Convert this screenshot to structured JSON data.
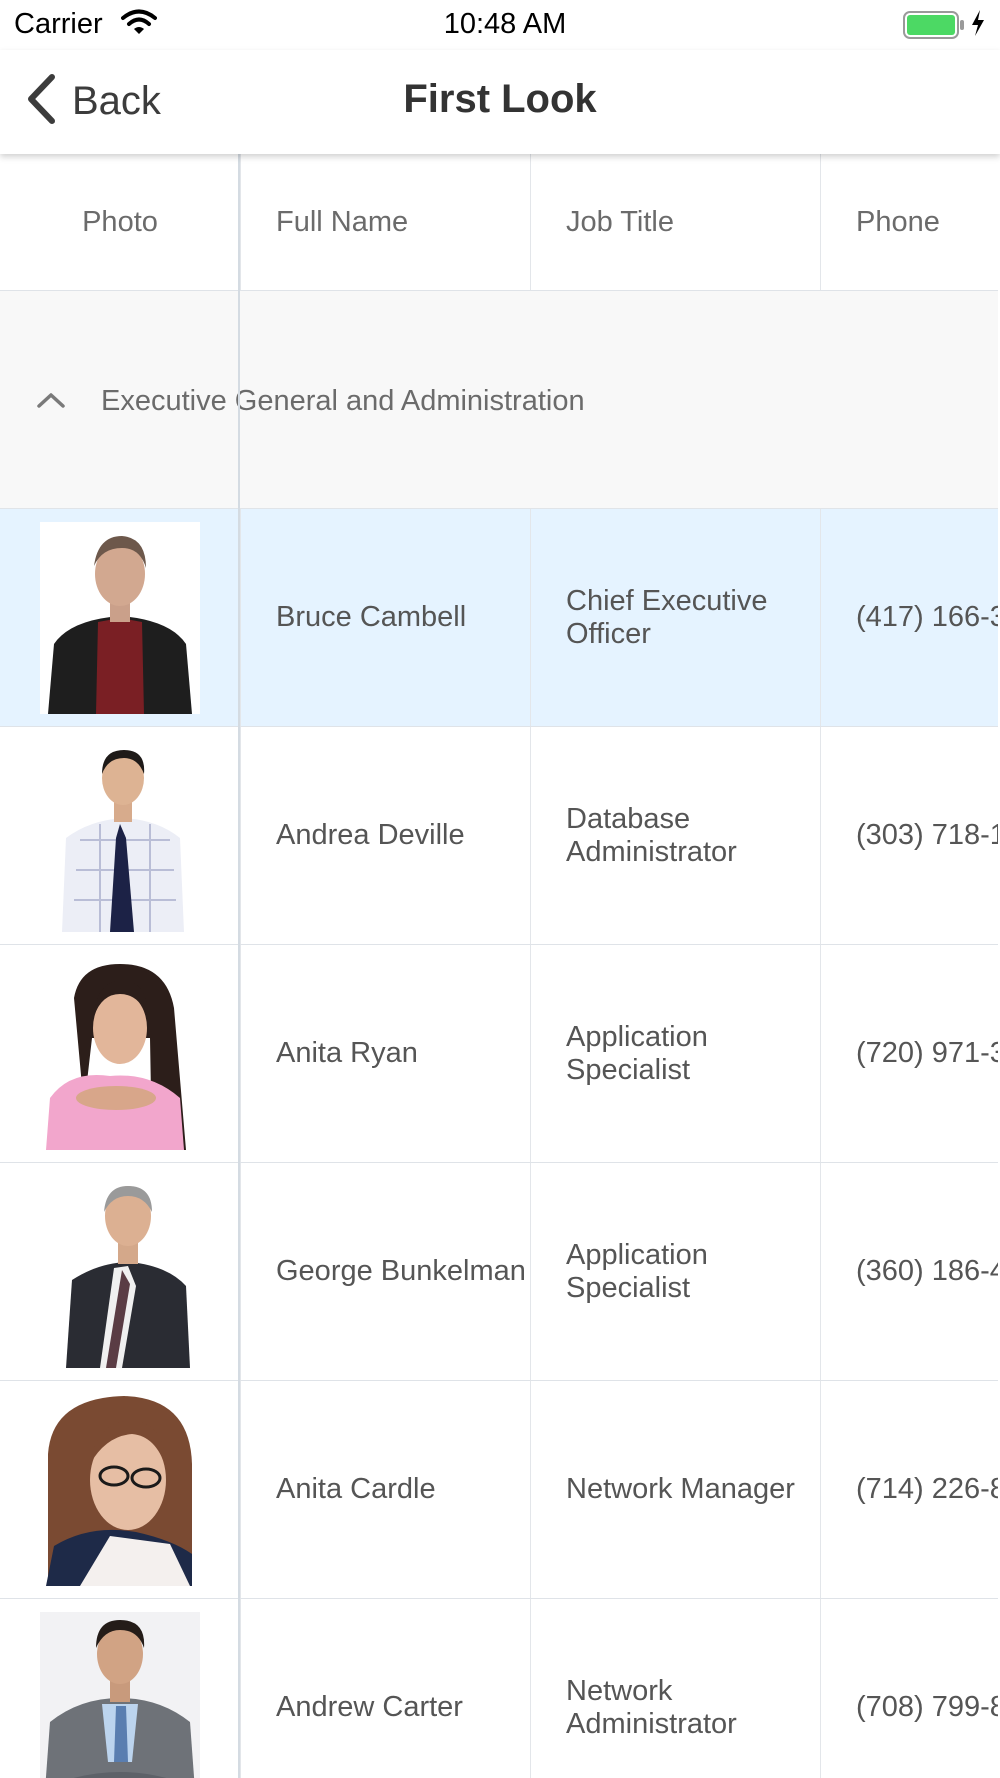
{
  "status_bar": {
    "carrier": "Carrier",
    "time": "10:48 AM",
    "icons": [
      "wifi-icon",
      "battery-icon",
      "charging-bolt-icon"
    ]
  },
  "nav": {
    "back_label": "Back",
    "title": "First Look"
  },
  "table": {
    "columns": [
      "Photo",
      "Full Name",
      "Job Title",
      "Phone"
    ],
    "group": {
      "label": "Executive General and Administration",
      "expanded": true
    },
    "rows": [
      {
        "name": "Bruce Cambell",
        "title": "Chief Executive Officer",
        "phone": "(417) 166-3",
        "selected": true
      },
      {
        "name": "Andrea Deville",
        "title": "Database Administrator",
        "phone": "(303) 718-1",
        "selected": false
      },
      {
        "name": "Anita Ryan",
        "title": "Application Specialist",
        "phone": "(720) 971-3",
        "selected": false
      },
      {
        "name": "George Bunkelman",
        "title": "Application Specialist",
        "phone": "(360) 186-4",
        "selected": false
      },
      {
        "name": "Anita Cardle",
        "title": "Network Manager",
        "phone": "(714) 226-8",
        "selected": false
      },
      {
        "name": "Andrew Carter",
        "title": "Network Administrator",
        "phone": "(708) 799-8",
        "selected": false
      }
    ]
  },
  "colors": {
    "selected_row": "#e5f3ff",
    "group_row": "#f8f8f8",
    "battery": "#4cd964"
  }
}
